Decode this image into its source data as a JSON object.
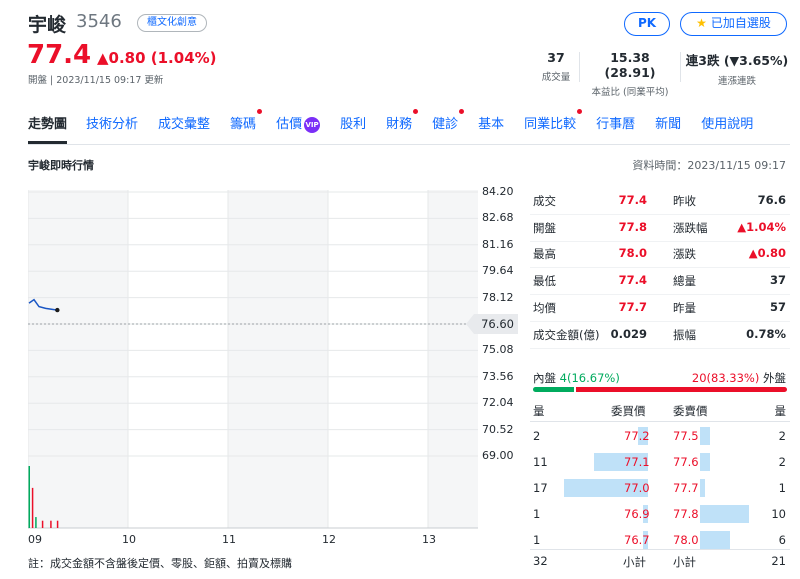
{
  "header": {
    "name": "宇峻",
    "code": "3546",
    "tag": "櫃文化創意",
    "pk_label": "PK",
    "watch_label": "已加自選股",
    "price": "77.4",
    "change": "▲0.80 (1.04%)",
    "status": "開盤 | 2023/11/15 09:17 更新",
    "stats": [
      {
        "value": "37",
        "label": "成交量"
      },
      {
        "value": "15.38 (28.91)",
        "label": "本益比 (同業平均)"
      },
      {
        "value_prefix": "連3跌",
        "value_suffix": "(▼3.65%)",
        "label": "連漲連跌"
      }
    ]
  },
  "tabs": [
    {
      "label": "走勢圖",
      "active": true,
      "dot": false
    },
    {
      "label": "技術分析",
      "active": false,
      "dot": false
    },
    {
      "label": "成交彙整",
      "active": false,
      "dot": false
    },
    {
      "label": "籌碼",
      "active": false,
      "dot": true
    },
    {
      "label": "估價",
      "active": false,
      "dot": false,
      "vip": "VIP"
    },
    {
      "label": "股利",
      "active": false,
      "dot": false
    },
    {
      "label": "財務",
      "active": false,
      "dot": true
    },
    {
      "label": "健診",
      "active": false,
      "dot": true
    },
    {
      "label": "基本",
      "active": false,
      "dot": false
    },
    {
      "label": "同業比較",
      "active": false,
      "dot": true
    },
    {
      "label": "行事曆",
      "active": false,
      "dot": false
    },
    {
      "label": "新聞",
      "active": false,
      "dot": false
    },
    {
      "label": "使用說明",
      "active": false,
      "dot": false
    }
  ],
  "section": {
    "title": "宇峻即時行情",
    "data_time": "資料時間：2023/11/15 09:17"
  },
  "chart_data": {
    "type": "line",
    "x_ticks": [
      "09",
      "10",
      "11",
      "12",
      "13"
    ],
    "y_ticks": [
      "84.20",
      "82.68",
      "81.16",
      "79.64",
      "78.12",
      "76.60",
      "75.08",
      "73.56",
      "72.04",
      "70.52",
      "69.00"
    ],
    "ylim": [
      69.0,
      84.2
    ],
    "prev_close": "76.60",
    "price_series": [
      {
        "t": 0,
        "v": 77.8
      },
      {
        "t": 3,
        "v": 78.0
      },
      {
        "t": 6,
        "v": 77.6
      },
      {
        "t": 10,
        "v": 77.5
      },
      {
        "t": 17,
        "v": 77.4
      }
    ],
    "volume_series": [
      {
        "t": 0,
        "v": 17,
        "up": true
      },
      {
        "t": 2,
        "v": 11,
        "up": false
      },
      {
        "t": 4,
        "v": 3,
        "up": true
      },
      {
        "t": 8,
        "v": 2,
        "up": false
      },
      {
        "t": 13,
        "v": 2,
        "up": false
      },
      {
        "t": 17,
        "v": 2,
        "up": false
      }
    ],
    "line_color": "#1a56c4",
    "up_color": "#00ab5e",
    "down_color": "#eb0f29"
  },
  "quote": {
    "rows": [
      {
        "l1": "成交",
        "v1": "77.4",
        "c1": "red",
        "l2": "昨收",
        "v2": "76.6",
        "c2": "black"
      },
      {
        "l1": "開盤",
        "v1": "77.8",
        "c1": "red",
        "l2": "漲跌幅",
        "v2": "▲1.04%",
        "c2": "red"
      },
      {
        "l1": "最高",
        "v1": "78.0",
        "c1": "red",
        "l2": "漲跌",
        "v2": "▲0.80",
        "c2": "red"
      },
      {
        "l1": "最低",
        "v1": "77.4",
        "c1": "red",
        "l2": "總量",
        "v2": "37",
        "c2": "black"
      },
      {
        "l1": "均價",
        "v1": "77.7",
        "c1": "red",
        "l2": "昨量",
        "v2": "57",
        "c2": "black"
      },
      {
        "l1": "成交金額(億)",
        "v1": "0.029",
        "c1": "black",
        "l2": "振幅",
        "v2": "0.78%",
        "c2": "black"
      }
    ],
    "inner_label": "內盤",
    "inner_value": "4",
    "inner_pct": "(16.67%)",
    "outer_value": "20",
    "outer_pct": "(83.33%)",
    "outer_label": "外盤",
    "inner_ratio": 0.1667
  },
  "orderbook": {
    "headers": [
      "量",
      "委買價",
      "委賣價",
      "量"
    ],
    "rows": [
      {
        "bid_vol": "2",
        "bid": "77.2",
        "ask": "77.5",
        "ask_vol": "2",
        "bid_n": 2,
        "ask_n": 2
      },
      {
        "bid_vol": "11",
        "bid": "77.1",
        "ask": "77.6",
        "ask_vol": "2",
        "bid_n": 11,
        "ask_n": 2
      },
      {
        "bid_vol": "17",
        "bid": "77.0",
        "ask": "77.7",
        "ask_vol": "1",
        "bid_n": 17,
        "ask_n": 1
      },
      {
        "bid_vol": "1",
        "bid": "76.9",
        "ask": "77.8",
        "ask_vol": "10",
        "bid_n": 1,
        "ask_n": 10
      },
      {
        "bid_vol": "1",
        "bid": "76.7",
        "ask": "78.0",
        "ask_vol": "6",
        "bid_n": 1,
        "ask_n": 6
      }
    ],
    "bid_total": "32",
    "subtotal_label": "小計",
    "ask_total": "21"
  },
  "footer": {
    "note": "註：成交金額不含盤後定價、零股、鉅額、拍賣及標購"
  }
}
